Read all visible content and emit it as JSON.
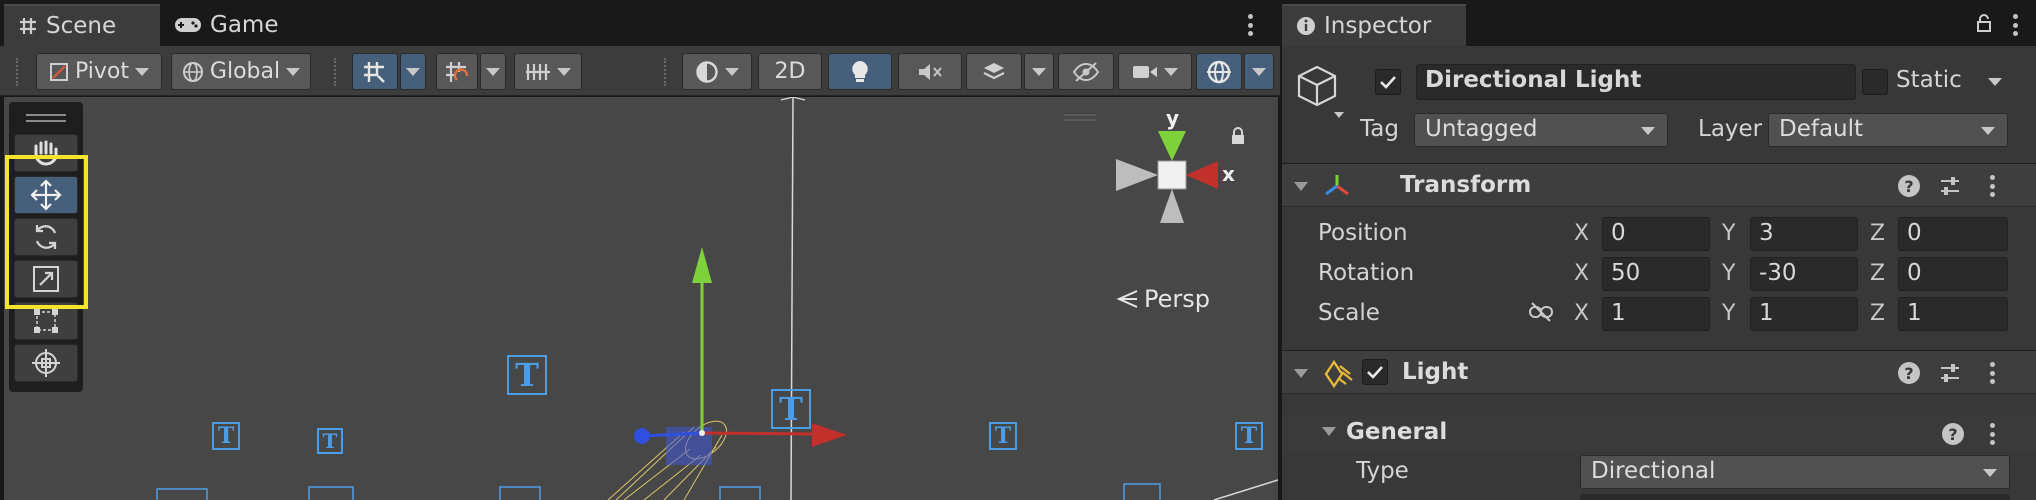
{
  "scene_tabs": {
    "scene": "Scene",
    "game": "Game"
  },
  "toolbar": {
    "pivot": "Pivot",
    "global": "Global",
    "mode_2d": "2D"
  },
  "viewport": {
    "persp_label": "Persp",
    "gizmo_x": "x",
    "gizmo_y": "y",
    "text_marker": "T"
  },
  "inspector": {
    "tab": "Inspector",
    "object": {
      "name": "Directional Light",
      "static_label": "Static",
      "tag_label": "Tag",
      "tag_value": "Untagged",
      "layer_label": "Layer",
      "layer_value": "Default"
    },
    "transform": {
      "title": "Transform",
      "rows": [
        {
          "label": "Position",
          "x": "0",
          "y": "3",
          "z": "0"
        },
        {
          "label": "Rotation",
          "x": "50",
          "y": "-30",
          "z": "0"
        },
        {
          "label": "Scale",
          "x": "1",
          "y": "1",
          "z": "1"
        }
      ],
      "axes": {
        "x": "X",
        "y": "Y",
        "z": "Z"
      }
    },
    "light": {
      "title": "Light",
      "section": "General",
      "type_label": "Type",
      "type_value": "Directional"
    }
  },
  "colors": {
    "accent_blue": "#46607c",
    "highlight_yellow": "#f4e52c",
    "axis_x": "#c1302b",
    "axis_y": "#7fd13b",
    "axis_z": "#2f4fe0",
    "text_marker": "#4b9ee6"
  }
}
